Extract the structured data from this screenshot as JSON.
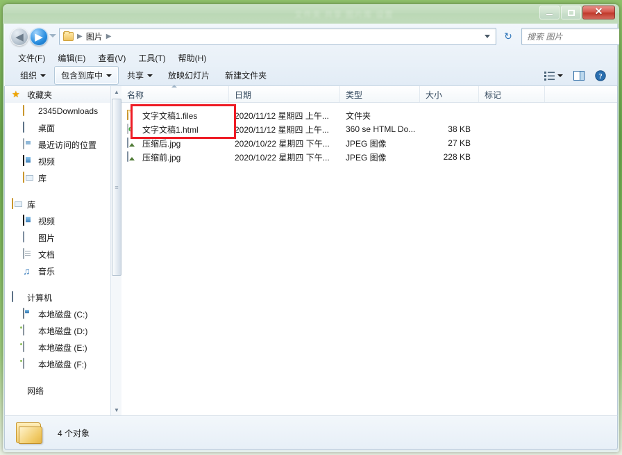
{
  "window": {
    "title_ghost": "文件夹   共享  图片库  设置",
    "buttons": {
      "minimize": "minimize-icon",
      "maximize": "maximize-icon",
      "close": "✕"
    }
  },
  "nav": {
    "back_label": "◀",
    "forward_label": "▶",
    "history_label": "history-dropdown",
    "breadcrumb": {
      "sep1": "▶",
      "folder": "图片",
      "sep2": "▶"
    },
    "refresh_label": "↻",
    "search": {
      "placeholder": "搜索 图片",
      "value": "",
      "icon": "search-icon"
    }
  },
  "menubar": {
    "items": [
      {
        "label": "文件(F)"
      },
      {
        "label": "编辑(E)"
      },
      {
        "label": "查看(V)"
      },
      {
        "label": "工具(T)"
      },
      {
        "label": "帮助(H)"
      }
    ]
  },
  "toolbar": {
    "organize": "组织",
    "include_in_library": "包含到库中",
    "share": "共享",
    "slideshow": "放映幻灯片",
    "new_folder": "新建文件夹",
    "view_icon": "view-list-icon",
    "preview_icon": "preview-pane-icon",
    "help_icon": "?"
  },
  "sidebar": {
    "sections": [
      {
        "header": {
          "label": "收藏夹",
          "icon": "star-icon"
        },
        "items": [
          {
            "label": "2345Downloads",
            "icon": "folder-icon"
          },
          {
            "label": "桌面",
            "icon": "desktop-icon"
          },
          {
            "label": "最近访问的位置",
            "icon": "recent-places-icon"
          },
          {
            "label": "视频",
            "icon": "video-icon"
          },
          {
            "label": "库",
            "icon": "library-icon"
          }
        ]
      },
      {
        "header": {
          "label": "库",
          "icon": "library-icon"
        },
        "items": [
          {
            "label": "视频",
            "icon": "video-icon"
          },
          {
            "label": "图片",
            "icon": "pictures-icon"
          },
          {
            "label": "文档",
            "icon": "documents-icon"
          },
          {
            "label": "音乐",
            "icon": "music-icon"
          }
        ]
      },
      {
        "header": {
          "label": "计算机",
          "icon": "computer-icon"
        },
        "items": [
          {
            "label": "本地磁盘 (C:)",
            "icon": "disk-system-icon"
          },
          {
            "label": "本地磁盘 (D:)",
            "icon": "disk-icon"
          },
          {
            "label": "本地磁盘 (E:)",
            "icon": "disk-icon"
          },
          {
            "label": "本地磁盘 (F:)",
            "icon": "disk-icon"
          }
        ]
      },
      {
        "header": {
          "label": "网络",
          "icon": "network-icon"
        },
        "items": []
      }
    ]
  },
  "filelist": {
    "columns": [
      {
        "label": "名称",
        "key": "name"
      },
      {
        "label": "日期",
        "key": "date"
      },
      {
        "label": "类型",
        "key": "type"
      },
      {
        "label": "大小",
        "key": "size"
      },
      {
        "label": "标记",
        "key": "tags"
      }
    ],
    "sort_column": "名称",
    "rows": [
      {
        "name": "文字文稿1.files",
        "icon": "folder-icon",
        "date": "2020/11/12 星期四 上午...",
        "type": "文件夹",
        "size": "",
        "tags": ""
      },
      {
        "name": "文字文稿1.html",
        "icon": "html-file-icon",
        "date": "2020/11/12 星期四 上午...",
        "type": "360 se HTML Do...",
        "size": "38 KB",
        "tags": ""
      },
      {
        "name": "压缩后.jpg",
        "icon": "jpeg-file-icon",
        "date": "2020/10/22 星期四 下午...",
        "type": "JPEG 图像",
        "size": "27 KB",
        "tags": ""
      },
      {
        "name": "压缩前.jpg",
        "icon": "jpeg-file-icon",
        "date": "2020/10/22 星期四 下午...",
        "type": "JPEG 图像",
        "size": "228 KB",
        "tags": ""
      }
    ]
  },
  "statusbar": {
    "count_text": "4 个对象",
    "icon": "folder-large-icon"
  },
  "annotation": {
    "color": "#ee1c25",
    "label": "highlight-box"
  }
}
